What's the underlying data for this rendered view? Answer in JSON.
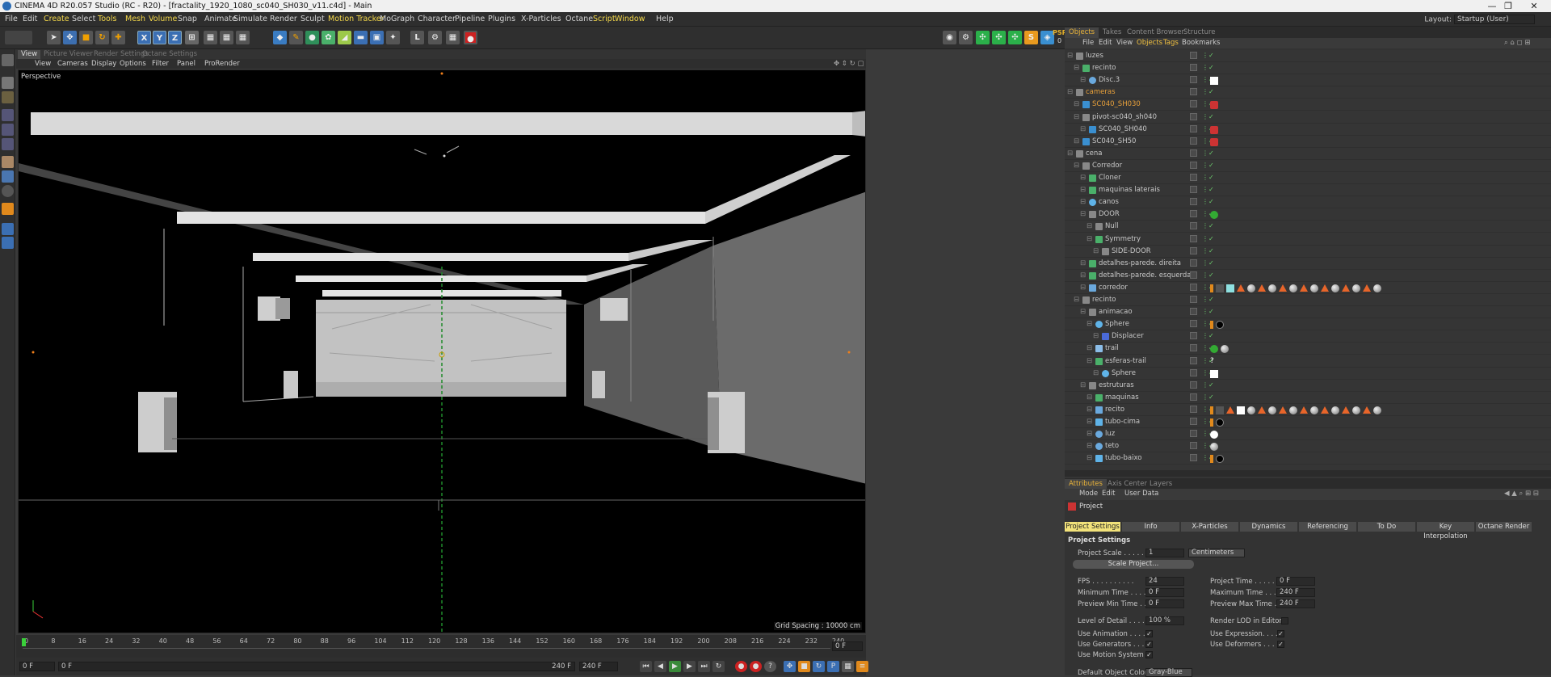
{
  "window": {
    "title": "CINEMA 4D R20.057 Studio (RC - R20) - [fractality_1920_1080_sc040_SH030_v11.c4d] - Main",
    "minimize": "—",
    "maximize": "❐",
    "close": "✕"
  },
  "menu": [
    "File",
    "Edit",
    "Create",
    "Select",
    "Tools",
    "Mesh",
    "Volume",
    "Snap",
    "Animate",
    "Simulate",
    "Render",
    "Sculpt",
    "Motion Tracker",
    "MoGraph",
    "Character",
    "Pipeline",
    "Plugins",
    "X-Particles",
    "Octane",
    "Script",
    "Window",
    "Help"
  ],
  "menu_highlight": [
    "Create",
    "Tools",
    "Mesh",
    "Volume",
    "Motion Tracker",
    "Script",
    "Window"
  ],
  "layout": {
    "label": "Layout:",
    "value": "Startup (User)"
  },
  "toolbar": {
    "axis": [
      "X",
      "Y",
      "Z"
    ],
    "psr": "PSR",
    "psr_val": "0"
  },
  "viewport": {
    "tabs": [
      "View",
      "Picture Viewer",
      "Render Settings",
      "Octane Settings"
    ],
    "menu": [
      "View",
      "Cameras",
      "Display",
      "Options",
      "Filter",
      "Panel",
      "ProRender"
    ],
    "label": "Perspective",
    "grid": "Grid Spacing : 10000 cm"
  },
  "timeline": {
    "ticks": [
      "0",
      "8",
      "16",
      "24",
      "32",
      "40",
      "48",
      "56",
      "64",
      "72",
      "80",
      "88",
      "96",
      "104",
      "112",
      "120",
      "128",
      "136",
      "144",
      "152",
      "160",
      "168",
      "176",
      "184",
      "192",
      "200",
      "208",
      "216",
      "224",
      "232",
      "240"
    ],
    "end_field": "0 F"
  },
  "transport": {
    "start": "0 F",
    "current": "0 F",
    "end1": "240 F",
    "end2": "240 F"
  },
  "objects": {
    "tabs": [
      "Objects",
      "Takes",
      "Content Browser",
      "Structure"
    ],
    "menu": [
      "File",
      "Edit",
      "View",
      "Objects",
      "Tags",
      "Bookmarks"
    ],
    "rows": [
      {
        "name": "luzes",
        "depth": 0,
        "icon": "null-icon",
        "tags": []
      },
      {
        "name": "recinto",
        "depth": 1,
        "icon": "cloner-icon",
        "tags": []
      },
      {
        "name": "Disc.3",
        "depth": 2,
        "icon": "disc-icon",
        "tags": [
          "white"
        ]
      },
      {
        "name": "cameras",
        "depth": 0,
        "icon": "null-icon",
        "orange": true,
        "tags": []
      },
      {
        "name": "SC040_SH030",
        "depth": 1,
        "icon": "camera-icon",
        "orange": true,
        "tags": [
          "cam"
        ]
      },
      {
        "name": "pivot-sc040_sh040",
        "depth": 1,
        "icon": "null-icon",
        "tags": []
      },
      {
        "name": "SC040_SH040",
        "depth": 2,
        "icon": "camera-icon",
        "tags": [
          "cam"
        ]
      },
      {
        "name": "SC040_SH50",
        "depth": 1,
        "icon": "camera-icon",
        "tags": [
          "cam"
        ]
      },
      {
        "name": "cena",
        "depth": 0,
        "icon": "null-icon",
        "tags": []
      },
      {
        "name": "Corredor",
        "depth": 1,
        "icon": "null-icon",
        "tags": []
      },
      {
        "name": "Cloner",
        "depth": 2,
        "icon": "cloner-icon",
        "tags": []
      },
      {
        "name": "maquinas laterais",
        "depth": 2,
        "icon": "cloner-icon",
        "tags": []
      },
      {
        "name": "canos",
        "depth": 2,
        "icon": "sphere-icon",
        "tags": []
      },
      {
        "name": "DOOR",
        "depth": 2,
        "icon": "null-icon",
        "tags": [
          "green"
        ]
      },
      {
        "name": "Null",
        "depth": 3,
        "icon": "null-icon",
        "tags": []
      },
      {
        "name": "Symmetry",
        "depth": 3,
        "icon": "symmetry-icon",
        "tags": []
      },
      {
        "name": "SIDE-DOOR",
        "depth": 4,
        "icon": "null-icon",
        "tags": []
      },
      {
        "name": "detalhes-parede. direita",
        "depth": 2,
        "icon": "cloner-icon",
        "tags": []
      },
      {
        "name": "detalhes-parede. esquerda",
        "depth": 2,
        "icon": "cloner-icon",
        "tags": []
      },
      {
        "name": "corredor",
        "depth": 2,
        "icon": "polygon-icon",
        "tags": [
          "many"
        ]
      },
      {
        "name": "recinto",
        "depth": 1,
        "icon": "null-icon",
        "tags": []
      },
      {
        "name": "animacao",
        "depth": 2,
        "icon": "null-icon",
        "tags": []
      },
      {
        "name": "Sphere",
        "depth": 3,
        "icon": "sphere-icon",
        "tags": [
          "black"
        ]
      },
      {
        "name": "Displacer",
        "depth": 4,
        "icon": "deformer-icon",
        "tags": []
      },
      {
        "name": "trail",
        "depth": 3,
        "icon": "spline-icon",
        "tags": [
          "green",
          "ball"
        ]
      },
      {
        "name": "esferas-trail",
        "depth": 3,
        "icon": "cloner-icon",
        "tags": [
          "question"
        ]
      },
      {
        "name": "Sphere",
        "depth": 4,
        "icon": "sphere-icon",
        "tags": [
          "white"
        ]
      },
      {
        "name": "estruturas",
        "depth": 2,
        "icon": "null-icon",
        "tags": []
      },
      {
        "name": "maquinas",
        "depth": 3,
        "icon": "cloner-icon",
        "tags": []
      },
      {
        "name": "recito",
        "depth": 3,
        "icon": "polygon-icon",
        "tags": [
          "many2"
        ]
      },
      {
        "name": "tubo-cima",
        "depth": 3,
        "icon": "tube-icon",
        "tags": [
          "black"
        ]
      },
      {
        "name": "luz",
        "depth": 3,
        "icon": "disc-icon",
        "tags": [
          "whiteball"
        ]
      },
      {
        "name": "teto",
        "depth": 3,
        "icon": "disc-icon",
        "tags": [
          "ball"
        ]
      },
      {
        "name": "tubo-baixo",
        "depth": 3,
        "icon": "tube-icon",
        "tags": [
          "black2"
        ]
      }
    ]
  },
  "attributes": {
    "tabs": [
      "Attributes",
      "Axis Center",
      "Layers"
    ],
    "menu": [
      "Mode",
      "Edit",
      "User Data"
    ],
    "object": "Project",
    "ptabs": [
      "Project Settings",
      "Info",
      "X-Particles",
      "Dynamics",
      "Referencing",
      "To Do",
      "Key Interpolation",
      "Octane Render"
    ],
    "section": "Project Settings",
    "scale_label": "Project Scale . . . . .",
    "scale_val": "1",
    "scale_unit": "Centimeters",
    "scale_btn": "Scale Project...",
    "fps_label": "FPS . . . . . . . . . .",
    "fps": "24",
    "min_label": "Minimum Time . . . .",
    "min": "0 F",
    "pmin_label": "Preview Min Time . .",
    "pmin": "0 F",
    "ptime_label": "Project Time . . . . .",
    "ptime": "0 F",
    "max_label": "Maximum Time . . . .",
    "max": "240 F",
    "pmax_label": "Preview Max Time . .",
    "pmax": "240 F",
    "lod_label": "Level of Detail . . . .",
    "lod": "100 %",
    "rlod_label": "Render LOD in Editor",
    "ua_label": "Use Animation . . . .",
    "ug_label": "Use Generators . . . .",
    "um_label": "Use Motion System",
    "ue_label": "Use Expression. . . .",
    "ud_label": "Use Deformers . . . .",
    "color_label": "Default Object Color",
    "color_val": "Gray-Blue",
    "check": "✓"
  }
}
